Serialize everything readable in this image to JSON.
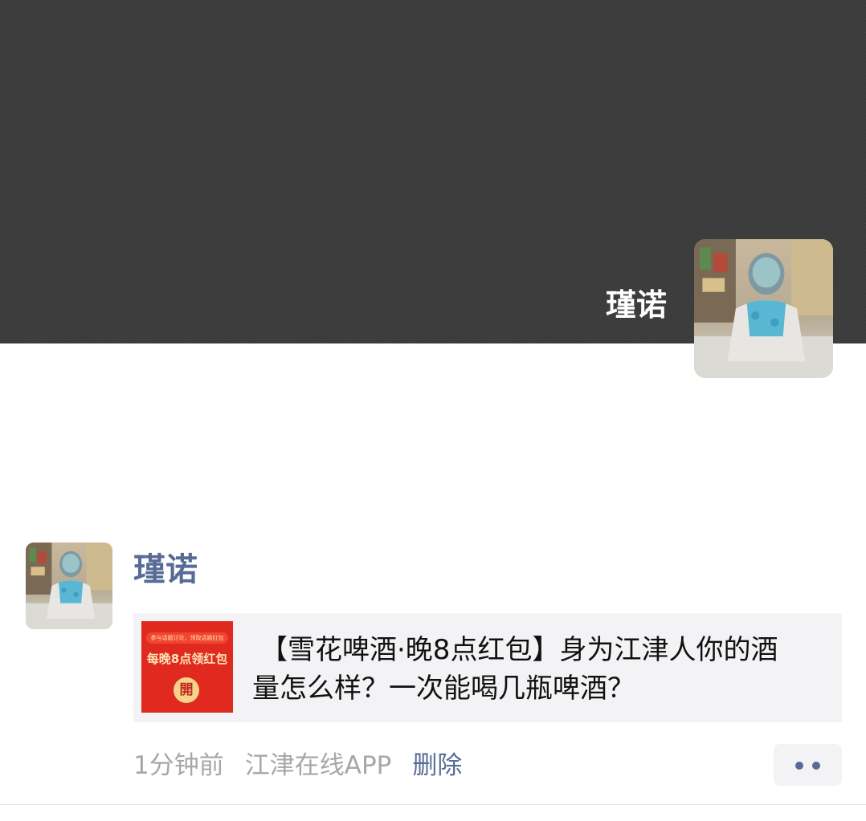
{
  "cover": {
    "user_name": "瑾诺"
  },
  "post": {
    "author": "瑾诺",
    "link": {
      "thumbnail_banner": "参与话题讨论，领取话题红包",
      "thumbnail_title": "每晚8点领红包",
      "thumbnail_button": "開",
      "title_line1": "【雪花啤酒·晚8点红包】身为江津人你的酒",
      "title_line2": "量怎么样？一次能喝几瓶啤酒？"
    },
    "time": "1分钟前",
    "source": "江津在线APP",
    "delete_label": "删除",
    "more_icon": "more-dots-icon"
  },
  "colors": {
    "cover_bg": "#3c3c3c",
    "link_blue": "#576b95",
    "meta_gray": "#a7a7a7",
    "card_bg": "#f3f3f5",
    "thumb_red": "#e02a20"
  }
}
